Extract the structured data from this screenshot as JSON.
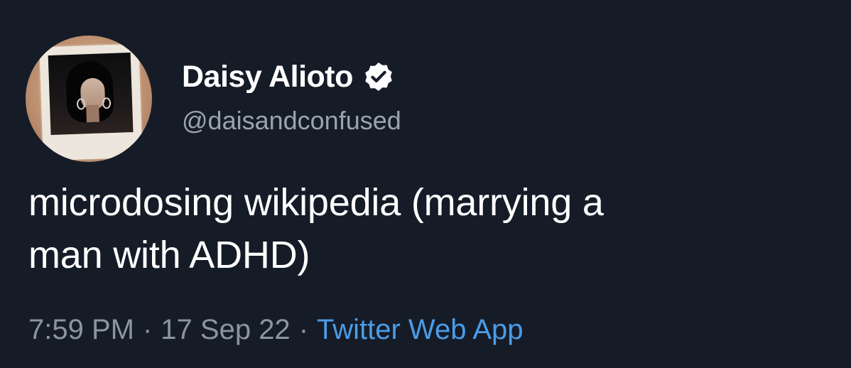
{
  "tweet": {
    "author": {
      "display_name": "Daisy Alioto",
      "handle": "@daisandconfused",
      "verified_icon": "verified-badge-icon",
      "avatar": "avatar"
    },
    "text_line_1": "microdosing wikipedia (marrying a",
    "text_line_2": "man with ADHD)",
    "time": "7:59 PM",
    "separator": "·",
    "date": "17 Sep 22",
    "source": "Twitter Web App"
  },
  "colors": {
    "background": "#151c27",
    "text": "#ffffff",
    "secondary_text": "#8b95a2",
    "link": "#4b9ce8",
    "verified_badge": "#ffffff"
  }
}
